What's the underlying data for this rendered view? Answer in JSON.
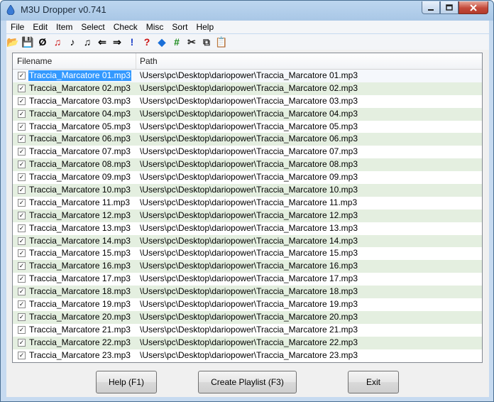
{
  "window": {
    "title": "M3U Dropper v0.741"
  },
  "menu": [
    "File",
    "Edit",
    "Item",
    "Select",
    "Check",
    "Misc",
    "Sort",
    "Help"
  ],
  "toolbar": [
    {
      "name": "open-folder-icon",
      "glyph": "📂",
      "color": "#c89a2a"
    },
    {
      "name": "save-icon",
      "glyph": "💾",
      "color": "#333"
    },
    {
      "name": "clear-icon",
      "glyph": "Ø",
      "color": "#000"
    },
    {
      "name": "music-note-red-icon",
      "glyph": "♫",
      "color": "#cc1111"
    },
    {
      "name": "music-note-icon",
      "glyph": "♪",
      "color": "#000"
    },
    {
      "name": "music-note-add-icon",
      "glyph": "♫",
      "color": "#000"
    },
    {
      "name": "arrow-left-icon",
      "glyph": "⇐",
      "color": "#000"
    },
    {
      "name": "arrow-right-icon",
      "glyph": "⇒",
      "color": "#000"
    },
    {
      "name": "exclamation-icon",
      "glyph": "!",
      "color": "#1a3fc8"
    },
    {
      "name": "question-icon",
      "glyph": "?",
      "color": "#cc1111"
    },
    {
      "name": "diamond-icon",
      "glyph": "◆",
      "color": "#1a6fd8"
    },
    {
      "name": "hash-icon",
      "glyph": "#",
      "color": "#1a8a1a"
    },
    {
      "name": "scissors-icon",
      "glyph": "✂",
      "color": "#222"
    },
    {
      "name": "copy-icon",
      "glyph": "⧉",
      "color": "#333"
    },
    {
      "name": "paste-icon",
      "glyph": "📋",
      "color": "#8a6a2a"
    }
  ],
  "columns": {
    "filename": "Filename",
    "path": "Path"
  },
  "rows": [
    {
      "file": "Traccia_Marcatore 01.mp3",
      "path": "\\Users\\pc\\Desktop\\dariopower\\Traccia_Marcatore 01.mp3"
    },
    {
      "file": "Traccia_Marcatore 02.mp3",
      "path": "\\Users\\pc\\Desktop\\dariopower\\Traccia_Marcatore 02.mp3"
    },
    {
      "file": "Traccia_Marcatore 03.mp3",
      "path": "\\Users\\pc\\Desktop\\dariopower\\Traccia_Marcatore 03.mp3"
    },
    {
      "file": "Traccia_Marcatore 04.mp3",
      "path": "\\Users\\pc\\Desktop\\dariopower\\Traccia_Marcatore 04.mp3"
    },
    {
      "file": "Traccia_Marcatore 05.mp3",
      "path": "\\Users\\pc\\Desktop\\dariopower\\Traccia_Marcatore 05.mp3"
    },
    {
      "file": "Traccia_Marcatore 06.mp3",
      "path": "\\Users\\pc\\Desktop\\dariopower\\Traccia_Marcatore 06.mp3"
    },
    {
      "file": "Traccia_Marcatore 07.mp3",
      "path": "\\Users\\pc\\Desktop\\dariopower\\Traccia_Marcatore 07.mp3"
    },
    {
      "file": "Traccia_Marcatore 08.mp3",
      "path": "\\Users\\pc\\Desktop\\dariopower\\Traccia_Marcatore 08.mp3"
    },
    {
      "file": "Traccia_Marcatore 09.mp3",
      "path": "\\Users\\pc\\Desktop\\dariopower\\Traccia_Marcatore 09.mp3"
    },
    {
      "file": "Traccia_Marcatore 10.mp3",
      "path": "\\Users\\pc\\Desktop\\dariopower\\Traccia_Marcatore 10.mp3"
    },
    {
      "file": "Traccia_Marcatore 11.mp3",
      "path": "\\Users\\pc\\Desktop\\dariopower\\Traccia_Marcatore 11.mp3"
    },
    {
      "file": "Traccia_Marcatore 12.mp3",
      "path": "\\Users\\pc\\Desktop\\dariopower\\Traccia_Marcatore 12.mp3"
    },
    {
      "file": "Traccia_Marcatore 13.mp3",
      "path": "\\Users\\pc\\Desktop\\dariopower\\Traccia_Marcatore 13.mp3"
    },
    {
      "file": "Traccia_Marcatore 14.mp3",
      "path": "\\Users\\pc\\Desktop\\dariopower\\Traccia_Marcatore 14.mp3"
    },
    {
      "file": "Traccia_Marcatore 15.mp3",
      "path": "\\Users\\pc\\Desktop\\dariopower\\Traccia_Marcatore 15.mp3"
    },
    {
      "file": "Traccia_Marcatore 16.mp3",
      "path": "\\Users\\pc\\Desktop\\dariopower\\Traccia_Marcatore 16.mp3"
    },
    {
      "file": "Traccia_Marcatore 17.mp3",
      "path": "\\Users\\pc\\Desktop\\dariopower\\Traccia_Marcatore 17.mp3"
    },
    {
      "file": "Traccia_Marcatore 18.mp3",
      "path": "\\Users\\pc\\Desktop\\dariopower\\Traccia_Marcatore 18.mp3"
    },
    {
      "file": "Traccia_Marcatore 19.mp3",
      "path": "\\Users\\pc\\Desktop\\dariopower\\Traccia_Marcatore 19.mp3"
    },
    {
      "file": "Traccia_Marcatore 20.mp3",
      "path": "\\Users\\pc\\Desktop\\dariopower\\Traccia_Marcatore 20.mp3"
    },
    {
      "file": "Traccia_Marcatore 21.mp3",
      "path": "\\Users\\pc\\Desktop\\dariopower\\Traccia_Marcatore 21.mp3"
    },
    {
      "file": "Traccia_Marcatore 22.mp3",
      "path": "\\Users\\pc\\Desktop\\dariopower\\Traccia_Marcatore 22.mp3"
    },
    {
      "file": "Traccia_Marcatore 23.mp3",
      "path": "\\Users\\pc\\Desktop\\dariopower\\Traccia_Marcatore 23.mp3"
    }
  ],
  "selected_row": 0,
  "buttons": {
    "help": "Help (F1)",
    "create": "Create Playlist (F3)",
    "exit": "Exit"
  },
  "colors": {
    "selection": "#3399ff",
    "alt_row": "#e4efe0",
    "close_button": "#c4493a"
  }
}
